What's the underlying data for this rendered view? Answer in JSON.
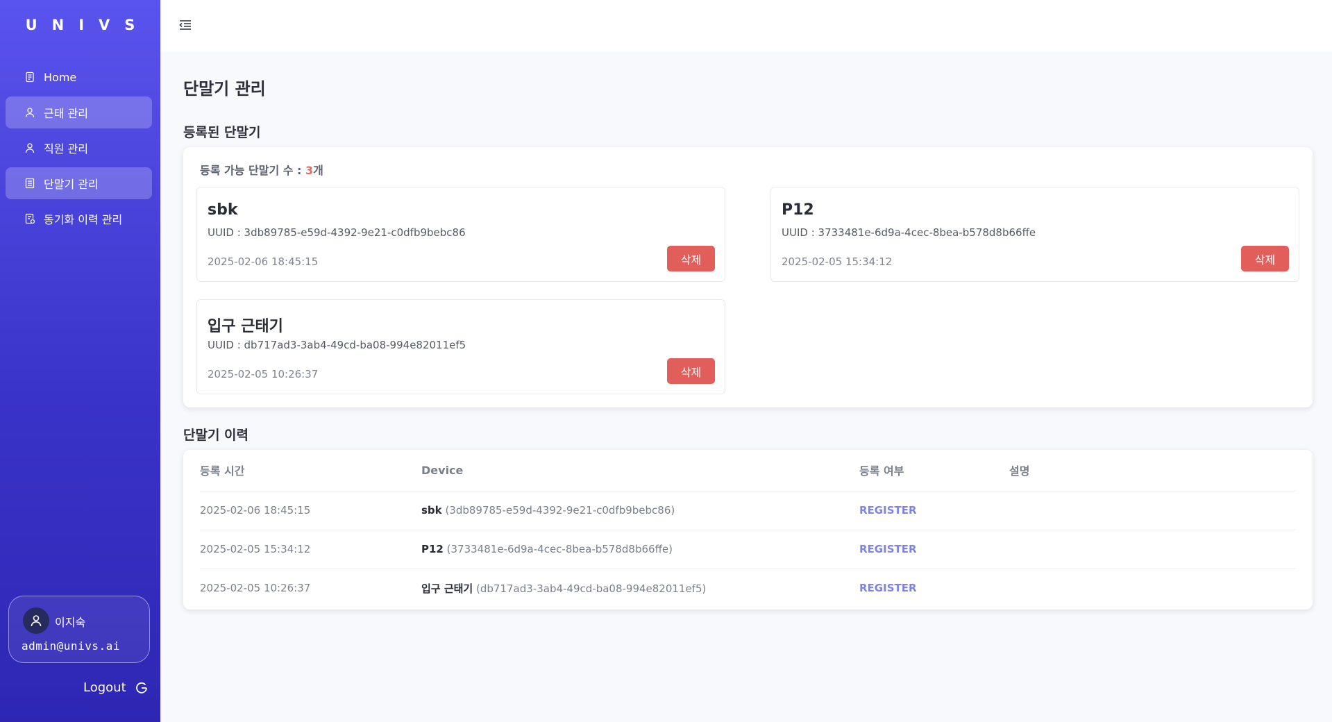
{
  "sidebar": {
    "brand": "UNIVS",
    "items": [
      {
        "label": "Home",
        "icon": "document-icon",
        "active": false
      },
      {
        "label": "근태 관리",
        "icon": "person-icon",
        "active": true
      },
      {
        "label": "직원 관리",
        "icon": "person-icon",
        "active": false
      },
      {
        "label": "단말기 관리",
        "icon": "list-icon",
        "active": true
      },
      {
        "label": "동기화 이력 관리",
        "icon": "history-doc-icon",
        "active": false
      }
    ],
    "user": {
      "name": "이지숙",
      "email": "admin@univs.ai"
    },
    "logout_label": "Logout"
  },
  "main": {
    "page_title": "단말기 관리",
    "registered": {
      "section_title": "등록된 단말기",
      "available_label": "등록 가능 단말기 수 :",
      "available_count": "3",
      "available_unit": "개",
      "devices": [
        {
          "name": "sbk",
          "uuid": "UUID : 3db89785-e59d-4392-9e21-c0dfb9bebc86",
          "date": "2025-02-06 18:45:15",
          "delete_label": "삭제"
        },
        {
          "name": "P12",
          "uuid": "UUID : 3733481e-6d9a-4cec-8bea-b578d8b66ffe",
          "date": "2025-02-05 15:34:12",
          "delete_label": "삭제"
        },
        {
          "name": "입구 근태기",
          "uuid": "UUID : db717ad3-3ab4-49cd-ba08-994e82011ef5",
          "date": "2025-02-05 10:26:37",
          "delete_label": "삭제"
        }
      ]
    },
    "history": {
      "section_title": "단말기 이력",
      "columns": [
        "등록 시간",
        "Device",
        "등록 여부",
        "설명"
      ],
      "rows": [
        {
          "time": "2025-02-06 18:45:15",
          "device_name": "sbk",
          "device_uuid": "(3db89785-e59d-4392-9e21-c0dfb9bebc86)",
          "status": "REGISTER",
          "desc": ""
        },
        {
          "time": "2025-02-05 15:34:12",
          "device_name": "P12",
          "device_uuid": "(3733481e-6d9a-4cec-8bea-b578d8b66ffe)",
          "status": "REGISTER",
          "desc": ""
        },
        {
          "time": "2025-02-05 10:26:37",
          "device_name": "입구 근태기",
          "device_uuid": "(db717ad3-3ab4-49cd-ba08-994e82011ef5)",
          "status": "REGISTER",
          "desc": ""
        }
      ]
    }
  },
  "colors": {
    "sidebar_top": "#5a54ee",
    "sidebar_bottom": "#2e26b3",
    "delete": "#e25e5a",
    "status": "#7f82e6",
    "count": "#e46a62"
  }
}
